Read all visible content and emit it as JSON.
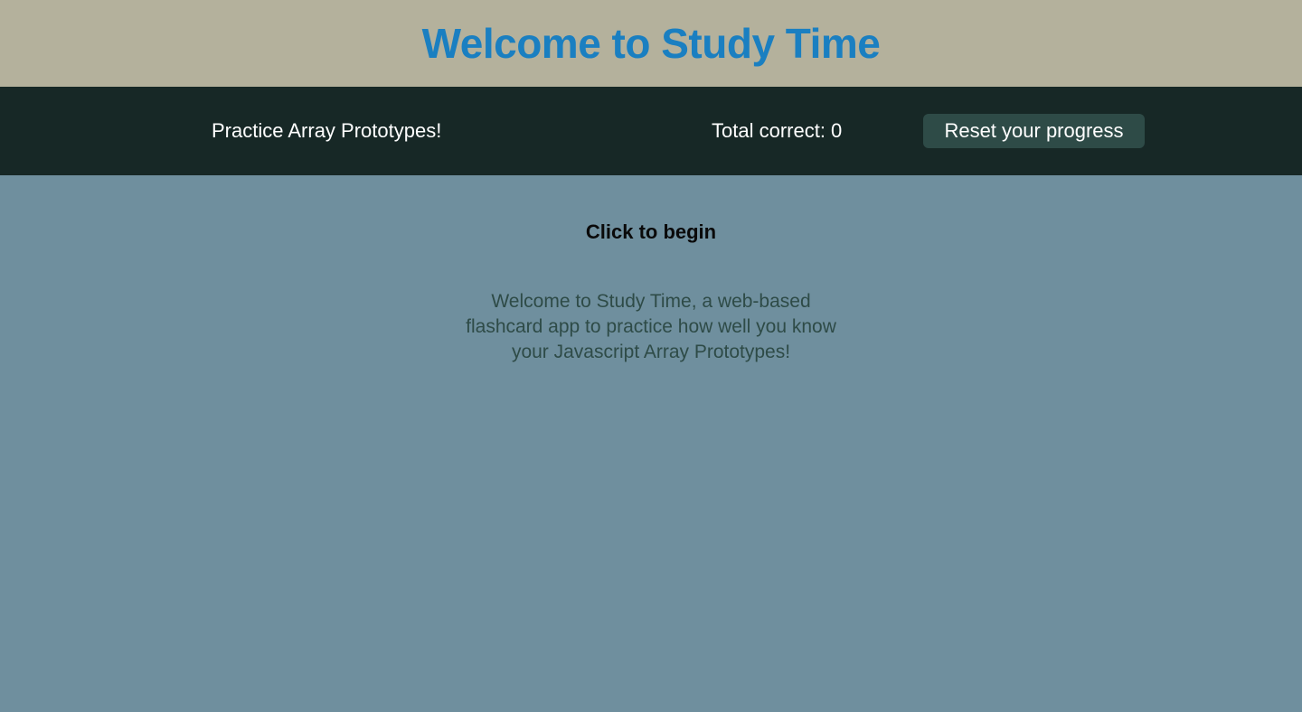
{
  "header": {
    "title": "Welcome to Study Time"
  },
  "nav": {
    "practice_label": "Practice Array Prototypes!",
    "total_correct": "Total correct: 0",
    "reset_label": "Reset your progress"
  },
  "main": {
    "begin_label": "Click to begin",
    "intro_text": "Welcome to Study Time, a web-based flashcard app to practice how well you know your Javascript Array Prototypes!"
  },
  "colors": {
    "title_bar_bg": "#b4b19c",
    "title_text": "#1a7fc1",
    "nav_bg": "#172826",
    "button_bg": "#2e4b47",
    "main_bg": "#6f8f9e",
    "intro_text": "#2e4b47"
  }
}
